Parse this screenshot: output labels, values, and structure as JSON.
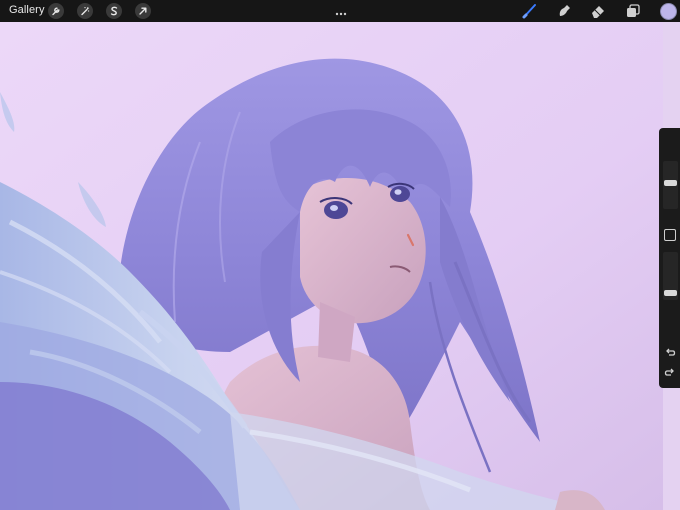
{
  "toolbar": {
    "gallery_label": "Gallery",
    "left_tools": [
      {
        "name": "actions",
        "icon": "wrench-icon"
      },
      {
        "name": "adjustments",
        "icon": "magic-wand-icon"
      },
      {
        "name": "selection",
        "icon": "selection-s-icon"
      },
      {
        "name": "transform",
        "icon": "arrow-cursor-icon"
      }
    ],
    "more_icon": "ellipsis-icon",
    "right_tools": [
      {
        "name": "brush",
        "icon": "brush-icon",
        "active": true
      },
      {
        "name": "smudge",
        "icon": "smudge-icon",
        "active": false
      },
      {
        "name": "eraser",
        "icon": "eraser-icon",
        "active": false
      },
      {
        "name": "layers",
        "icon": "layers-icon",
        "active": false
      }
    ],
    "current_color": "#bdb5ea",
    "accent_color": "#3b7bff"
  },
  "sidebar": {
    "brush_size_level": 0.55,
    "opacity_level": 0.1,
    "modify_icon": "square-icon",
    "undo_icon": "undo-arrow-icon",
    "redo_icon": "redo-arrow-icon"
  },
  "canvas": {
    "subject": "anime-girl-with-lavender-hair-and-wings-illustration",
    "background_color": "#e6d2f4",
    "hair_color": "#8e87d8",
    "skin_color": "#d9b2c6",
    "wing_color": "#b9c8ea"
  }
}
